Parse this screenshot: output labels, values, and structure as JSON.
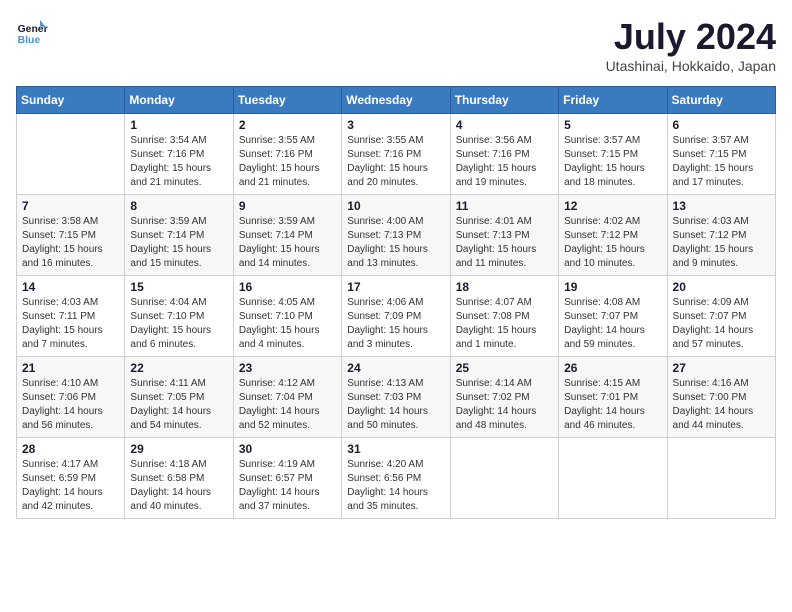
{
  "header": {
    "logo_line1": "General",
    "logo_line2": "Blue",
    "title": "July 2024",
    "subtitle": "Utashinai, Hokkaido, Japan"
  },
  "weekdays": [
    "Sunday",
    "Monday",
    "Tuesday",
    "Wednesday",
    "Thursday",
    "Friday",
    "Saturday"
  ],
  "weeks": [
    [
      {
        "day": "",
        "info": ""
      },
      {
        "day": "1",
        "info": "Sunrise: 3:54 AM\nSunset: 7:16 PM\nDaylight: 15 hours\nand 21 minutes."
      },
      {
        "day": "2",
        "info": "Sunrise: 3:55 AM\nSunset: 7:16 PM\nDaylight: 15 hours\nand 21 minutes."
      },
      {
        "day": "3",
        "info": "Sunrise: 3:55 AM\nSunset: 7:16 PM\nDaylight: 15 hours\nand 20 minutes."
      },
      {
        "day": "4",
        "info": "Sunrise: 3:56 AM\nSunset: 7:16 PM\nDaylight: 15 hours\nand 19 minutes."
      },
      {
        "day": "5",
        "info": "Sunrise: 3:57 AM\nSunset: 7:15 PM\nDaylight: 15 hours\nand 18 minutes."
      },
      {
        "day": "6",
        "info": "Sunrise: 3:57 AM\nSunset: 7:15 PM\nDaylight: 15 hours\nand 17 minutes."
      }
    ],
    [
      {
        "day": "7",
        "info": "Sunrise: 3:58 AM\nSunset: 7:15 PM\nDaylight: 15 hours\nand 16 minutes."
      },
      {
        "day": "8",
        "info": "Sunrise: 3:59 AM\nSunset: 7:14 PM\nDaylight: 15 hours\nand 15 minutes."
      },
      {
        "day": "9",
        "info": "Sunrise: 3:59 AM\nSunset: 7:14 PM\nDaylight: 15 hours\nand 14 minutes."
      },
      {
        "day": "10",
        "info": "Sunrise: 4:00 AM\nSunset: 7:13 PM\nDaylight: 15 hours\nand 13 minutes."
      },
      {
        "day": "11",
        "info": "Sunrise: 4:01 AM\nSunset: 7:13 PM\nDaylight: 15 hours\nand 11 minutes."
      },
      {
        "day": "12",
        "info": "Sunrise: 4:02 AM\nSunset: 7:12 PM\nDaylight: 15 hours\nand 10 minutes."
      },
      {
        "day": "13",
        "info": "Sunrise: 4:03 AM\nSunset: 7:12 PM\nDaylight: 15 hours\nand 9 minutes."
      }
    ],
    [
      {
        "day": "14",
        "info": "Sunrise: 4:03 AM\nSunset: 7:11 PM\nDaylight: 15 hours\nand 7 minutes."
      },
      {
        "day": "15",
        "info": "Sunrise: 4:04 AM\nSunset: 7:10 PM\nDaylight: 15 hours\nand 6 minutes."
      },
      {
        "day": "16",
        "info": "Sunrise: 4:05 AM\nSunset: 7:10 PM\nDaylight: 15 hours\nand 4 minutes."
      },
      {
        "day": "17",
        "info": "Sunrise: 4:06 AM\nSunset: 7:09 PM\nDaylight: 15 hours\nand 3 minutes."
      },
      {
        "day": "18",
        "info": "Sunrise: 4:07 AM\nSunset: 7:08 PM\nDaylight: 15 hours\nand 1 minute."
      },
      {
        "day": "19",
        "info": "Sunrise: 4:08 AM\nSunset: 7:07 PM\nDaylight: 14 hours\nand 59 minutes."
      },
      {
        "day": "20",
        "info": "Sunrise: 4:09 AM\nSunset: 7:07 PM\nDaylight: 14 hours\nand 57 minutes."
      }
    ],
    [
      {
        "day": "21",
        "info": "Sunrise: 4:10 AM\nSunset: 7:06 PM\nDaylight: 14 hours\nand 56 minutes."
      },
      {
        "day": "22",
        "info": "Sunrise: 4:11 AM\nSunset: 7:05 PM\nDaylight: 14 hours\nand 54 minutes."
      },
      {
        "day": "23",
        "info": "Sunrise: 4:12 AM\nSunset: 7:04 PM\nDaylight: 14 hours\nand 52 minutes."
      },
      {
        "day": "24",
        "info": "Sunrise: 4:13 AM\nSunset: 7:03 PM\nDaylight: 14 hours\nand 50 minutes."
      },
      {
        "day": "25",
        "info": "Sunrise: 4:14 AM\nSunset: 7:02 PM\nDaylight: 14 hours\nand 48 minutes."
      },
      {
        "day": "26",
        "info": "Sunrise: 4:15 AM\nSunset: 7:01 PM\nDaylight: 14 hours\nand 46 minutes."
      },
      {
        "day": "27",
        "info": "Sunrise: 4:16 AM\nSunset: 7:00 PM\nDaylight: 14 hours\nand 44 minutes."
      }
    ],
    [
      {
        "day": "28",
        "info": "Sunrise: 4:17 AM\nSunset: 6:59 PM\nDaylight: 14 hours\nand 42 minutes."
      },
      {
        "day": "29",
        "info": "Sunrise: 4:18 AM\nSunset: 6:58 PM\nDaylight: 14 hours\nand 40 minutes."
      },
      {
        "day": "30",
        "info": "Sunrise: 4:19 AM\nSunset: 6:57 PM\nDaylight: 14 hours\nand 37 minutes."
      },
      {
        "day": "31",
        "info": "Sunrise: 4:20 AM\nSunset: 6:56 PM\nDaylight: 14 hours\nand 35 minutes."
      },
      {
        "day": "",
        "info": ""
      },
      {
        "day": "",
        "info": ""
      },
      {
        "day": "",
        "info": ""
      }
    ]
  ]
}
